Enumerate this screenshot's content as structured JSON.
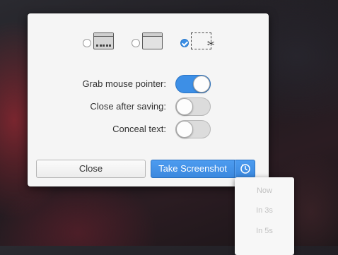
{
  "capture_modes": [
    {
      "name": "grab-whole-screen",
      "icon": "screen-icon",
      "selected": false
    },
    {
      "name": "grab-current-window",
      "icon": "window-icon",
      "selected": false
    },
    {
      "name": "select-area",
      "icon": "selection-scissors-icon",
      "selected": true
    }
  ],
  "options": {
    "grab_pointer_label": "Grab mouse pointer:",
    "grab_pointer_on": true,
    "close_after_saving_label": "Close after saving:",
    "close_after_saving_on": false,
    "conceal_text_label": "Conceal text:",
    "conceal_text_on": false
  },
  "buttons": {
    "close_label": "Close",
    "take_label": "Take Screenshot",
    "delay_icon": "timer-icon"
  },
  "delay_menu": {
    "items": [
      "Now",
      "In 3s",
      "In 5s"
    ]
  },
  "colors": {
    "accent": "#3d8fe6",
    "dialog_bg": "#f5f5f5"
  }
}
